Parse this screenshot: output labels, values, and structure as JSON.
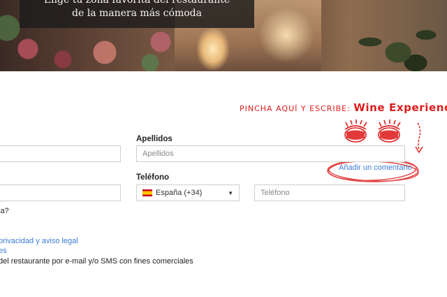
{
  "hero": {
    "line1": "Elige tu zona favorita del restaurante",
    "line2": "de la manera más cómoda"
  },
  "annotation": {
    "instruction": "PINCHA AQUÍ Y ESCRIBE:",
    "highlight": "Wine Experience",
    "color": "#dd1d1d"
  },
  "form": {
    "apellidos_label": "Apellidos",
    "apellidos_placeholder": "Apellidos",
    "add_comment_link": "Añadir un comentario",
    "telefono_label": "Teléfono",
    "country_selected": "España (+34)",
    "telefono_placeholder": "Teléfono",
    "question_fragment": "ia?",
    "privacy_link": "privacidad y aviso legal",
    "link_fragment": "es",
    "marketing_text": "del restaurante por e-mail y/o SMS con fines comerciales"
  },
  "colors": {
    "link": "#3d7bd6",
    "accent_red": "#dd1d1d"
  }
}
